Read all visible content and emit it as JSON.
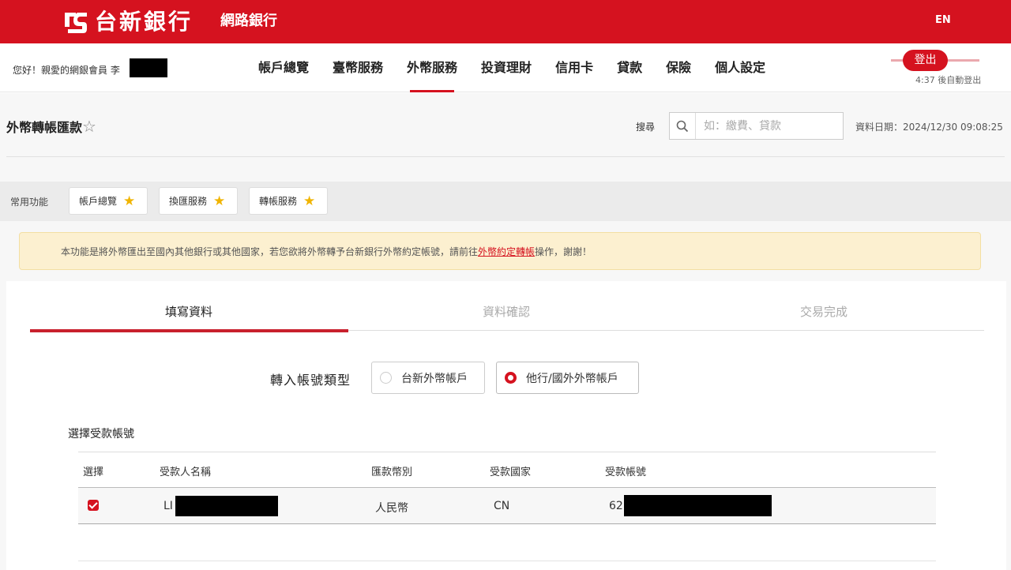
{
  "header": {
    "brand": "台新銀行",
    "subbrand": "網路銀行",
    "language": "EN",
    "brand_color": "#d5121f"
  },
  "nav": {
    "greeting": "您好！親愛的網銀會員 李",
    "items": [
      "帳戶總覽",
      "臺幣服務",
      "外幣服務",
      "投資理財",
      "信用卡",
      "貸款",
      "保險",
      "個人設定"
    ],
    "active": "外幣服務",
    "logout_label": "登出",
    "auto_logout": "4:37 後自動登出"
  },
  "page": {
    "title": "外幣轉帳匯款",
    "title_star": "☆",
    "search_label": "搜尋",
    "search_placeholder": "如：繳費、貸款",
    "data_date": "資料日期：2024/12/30 09:08:25"
  },
  "quick": {
    "label": "常用功能",
    "items": [
      "帳戶總覽",
      "換匯服務",
      "轉帳服務"
    ]
  },
  "notice": {
    "text_before": "本功能是將外幣匯出至國內其他銀行或其他國家，若您欲將外幣轉予台新銀行外幣約定帳號，請前往",
    "link": "外幣約定轉帳",
    "text_after": "操作，謝謝！"
  },
  "steps": [
    "填寫資料",
    "資料確認",
    "交易完成"
  ],
  "form": {
    "account_type_label": "轉入帳號類型",
    "options": [
      "台新外幣帳戶",
      "他行/國外外幣帳戶"
    ],
    "selected_option": "他行/國外外幣帳戶",
    "select_payee_label": "選擇受款帳號"
  },
  "table": {
    "headers": [
      "選擇",
      "受款人名稱",
      "匯款幣別",
      "受款國家",
      "受款帳號"
    ],
    "rows": [
      {
        "checked": true,
        "name_prefix": "LI",
        "currency": "人民幣",
        "country": "CN",
        "account_prefix": "62"
      }
    ]
  }
}
